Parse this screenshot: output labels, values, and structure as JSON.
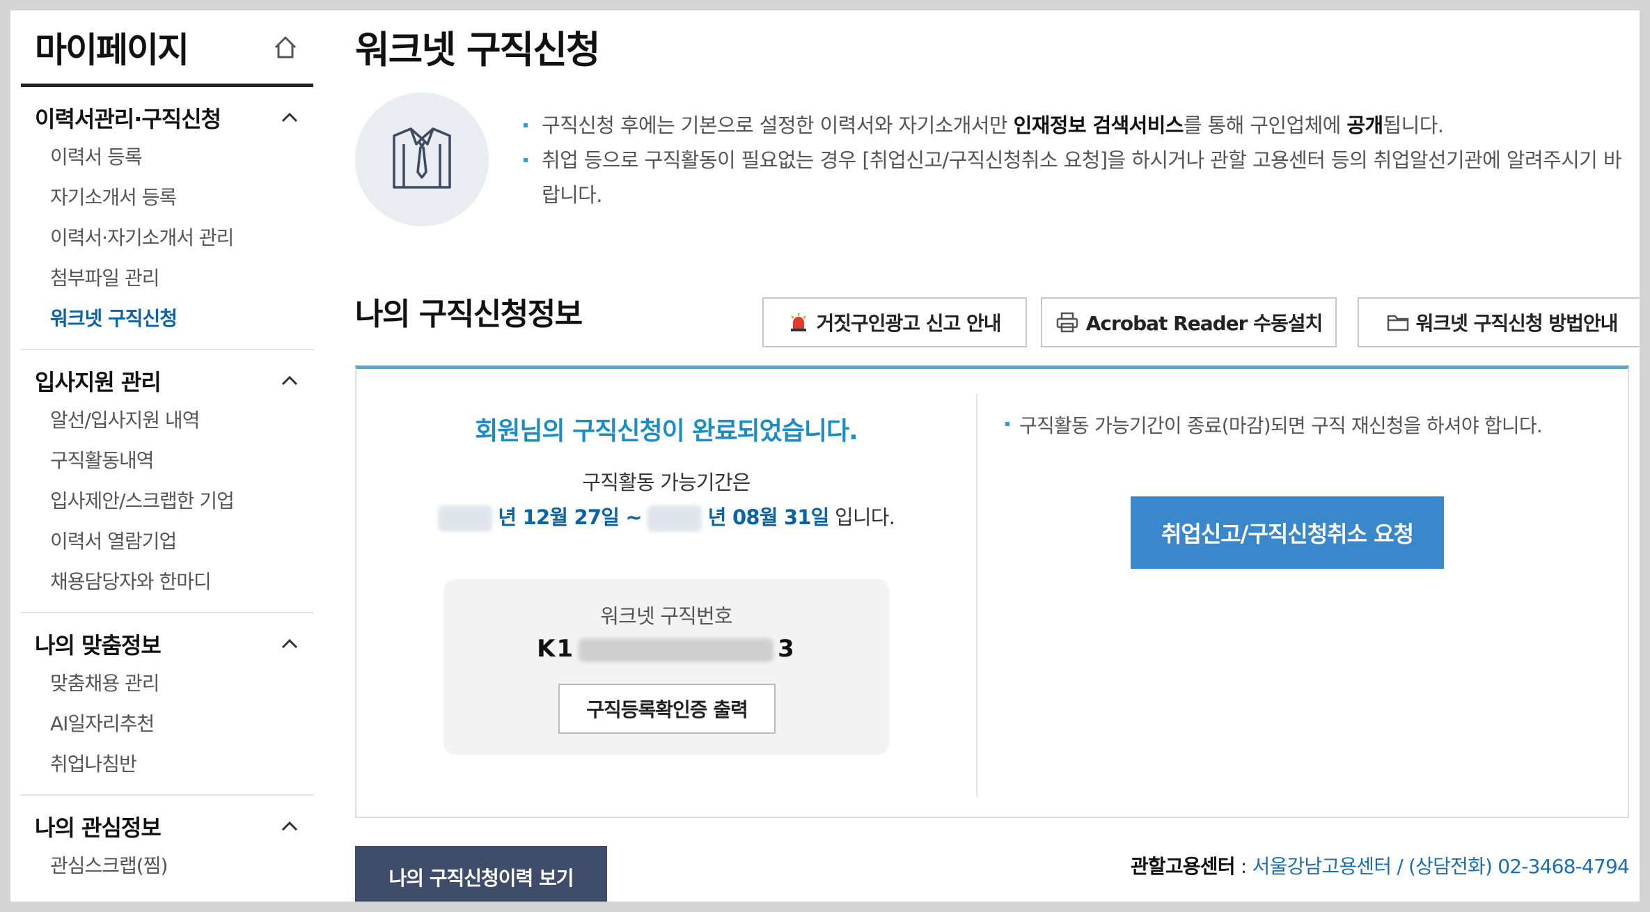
{
  "sidebar": {
    "title": "마이페이지",
    "groups": [
      {
        "title": "이력서관리·구직신청",
        "items": [
          "이력서 등록",
          "자기소개서 등록",
          "이력서·자기소개서 관리",
          "첨부파일 관리",
          "워크넷 구직신청"
        ]
      },
      {
        "title": "입사지원 관리",
        "items": [
          "알선/입사지원 내역",
          "구직활동내역",
          "입사제안/스크랩한 기업",
          "이력서 열람기업",
          "채용담당자와 한마디"
        ]
      },
      {
        "title": "나의 맞춤정보",
        "items": [
          "맞춤채용 관리",
          "AI일자리추천",
          "취업나침반"
        ]
      },
      {
        "title": "나의 관심정보",
        "items": [
          "관심스크랩(찜)"
        ]
      }
    ],
    "active_item": "워크넷 구직신청"
  },
  "main": {
    "title": "워크넷 구직신청",
    "intro": {
      "line1_a": "구직신청 후에는 기본으로 설정한 이력서와 자기소개서만 ",
      "line1_b": "인재정보 검색서비스",
      "line1_c": "를 통해 구인업체에 ",
      "line1_d": "공개",
      "line1_e": "됩니다.",
      "line2": "취업 등으로 구직활동이 필요없는 경우 [취업신고/구직신청취소 요청]을 하시거나 관할 고용센터 등의 취업알선기관에 알려주시기 바랍니다."
    },
    "section_title": "나의 구직신청정보",
    "toolbar": {
      "fake_ad": "거짓구인광고 신고 안내",
      "acrobat": "Acrobat Reader 수동설치",
      "guide": "워크넷 구직신청 방법안내"
    },
    "status": {
      "done_message": "회원님의 구직신청이 완료되었습니다.",
      "period_label": "구직활동 가능기간은",
      "period_start": "년 12월 27일 ~",
      "period_end": "년 08월 31일",
      "period_suffix": " 입니다.",
      "number_label": "워크넷 구직번호",
      "number_prefix": "K1",
      "number_suffix": "3",
      "print_button": "구직등록확인증 출력"
    },
    "right": {
      "note": "구직활동 가능기간이 종료(마감)되면 구직 재신청을 하셔야 합니다.",
      "request_button": "취업신고/구직신청취소 요청"
    },
    "history_button": "나의 구직신청이력 보기",
    "center": {
      "label": "관할고용센터",
      "sep": " : ",
      "value": "서울강남고용센터 / (상담전화) 02-3468-4794"
    }
  },
  "colors": {
    "accent_blue": "#1a8ec4",
    "button_blue": "#3a87cc",
    "dark_button": "#3f4d6b",
    "active_link": "#0a63a8"
  }
}
